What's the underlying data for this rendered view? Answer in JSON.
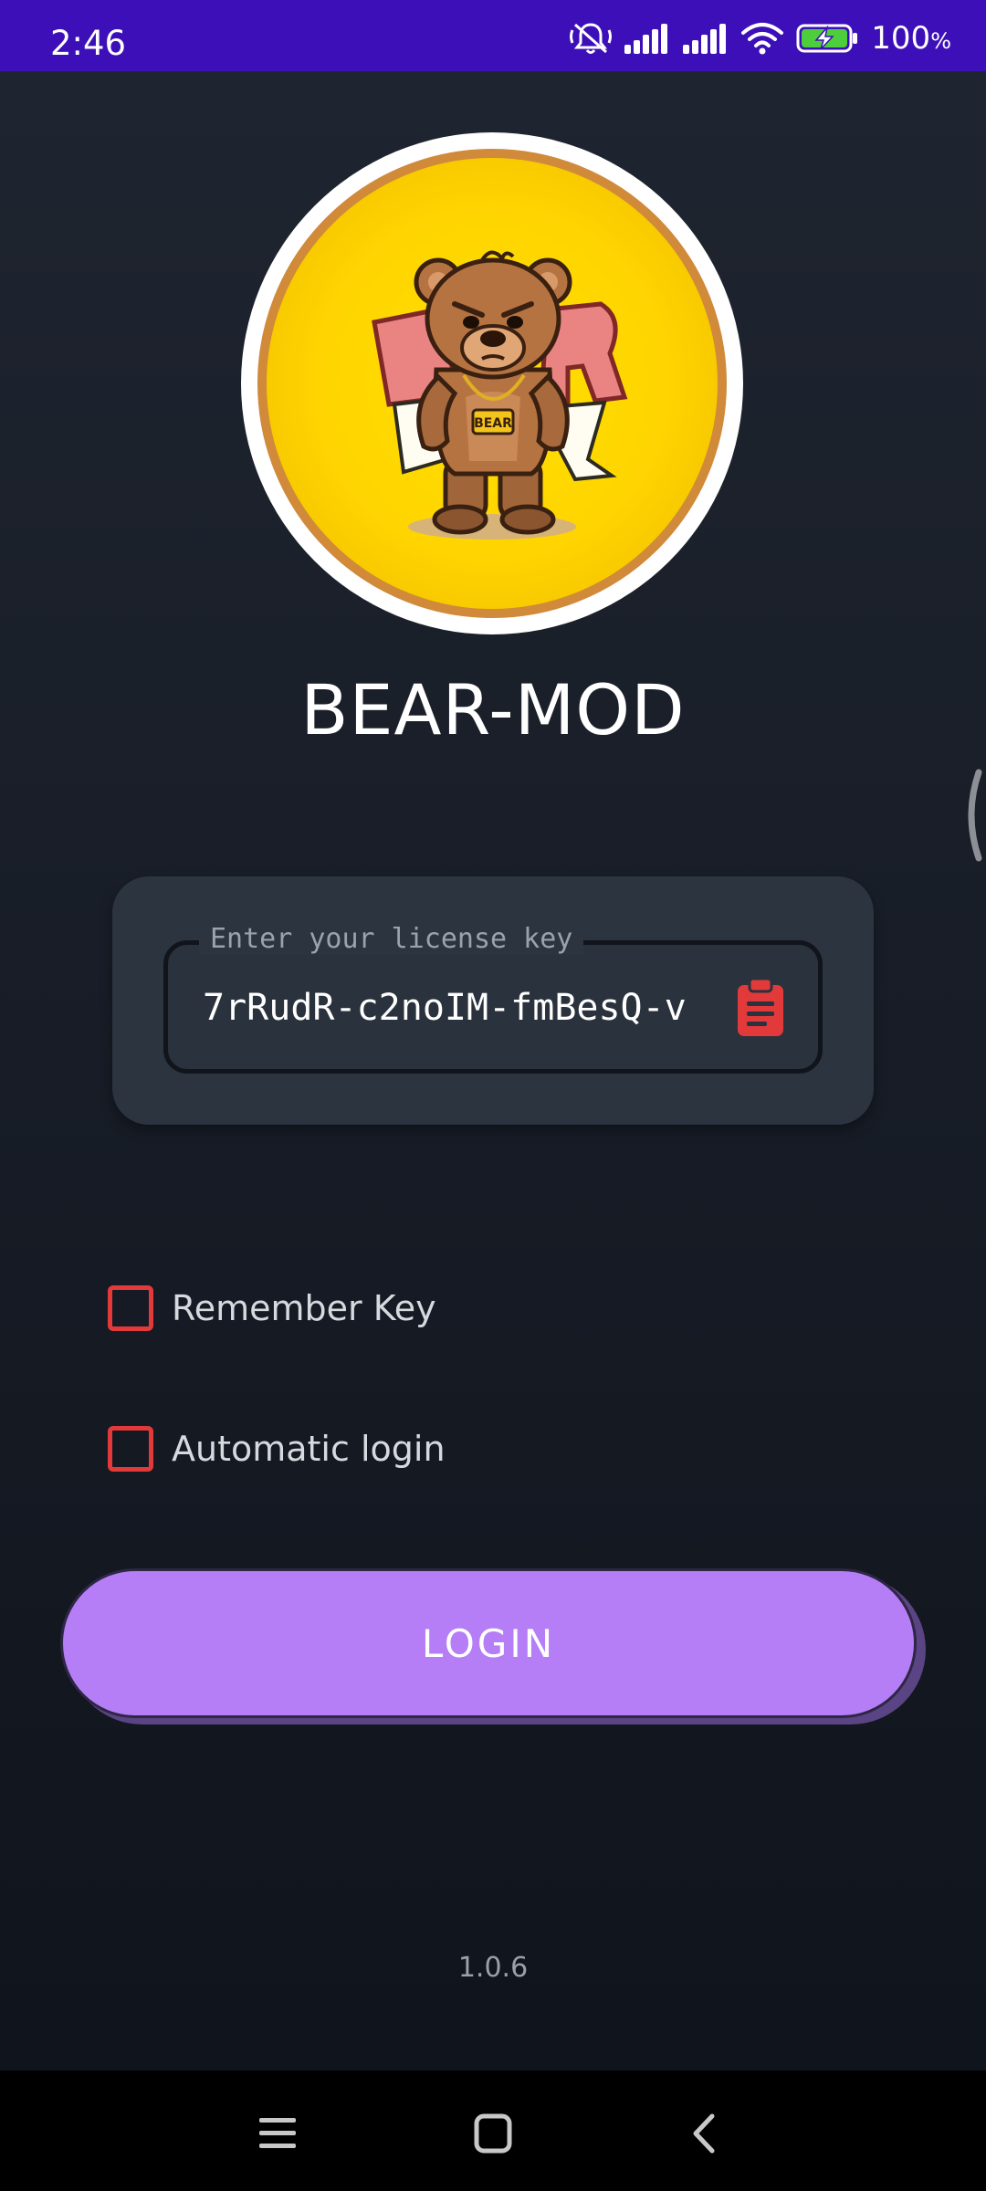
{
  "status_bar": {
    "time": "2:46",
    "battery_percent": "100",
    "battery_unit": "%",
    "icons": [
      "mute-icon",
      "signal-icon",
      "signal-icon",
      "wifi-icon",
      "battery-charging-icon"
    ]
  },
  "app": {
    "title": "BEAR-MOD",
    "logo": "bear-logo",
    "license_field": {
      "label": "Enter your license key",
      "value": "7rRudR-c2noIM-fmBesQ-v",
      "paste_icon": "clipboard-icon"
    },
    "remember_key": {
      "label": "Remember Key",
      "checked": false
    },
    "auto_login": {
      "label": "Automatic login",
      "checked": false
    },
    "login_button": "LOGIN",
    "version": "1.0.6"
  },
  "colors": {
    "status_bar": "#3d0fb8",
    "accent_button": "#b57ef6",
    "checkbox_border": "#e23a3a",
    "card": "#2c3440"
  },
  "nav_bar": {
    "buttons": [
      "menu-icon",
      "home-icon",
      "back-icon"
    ]
  }
}
